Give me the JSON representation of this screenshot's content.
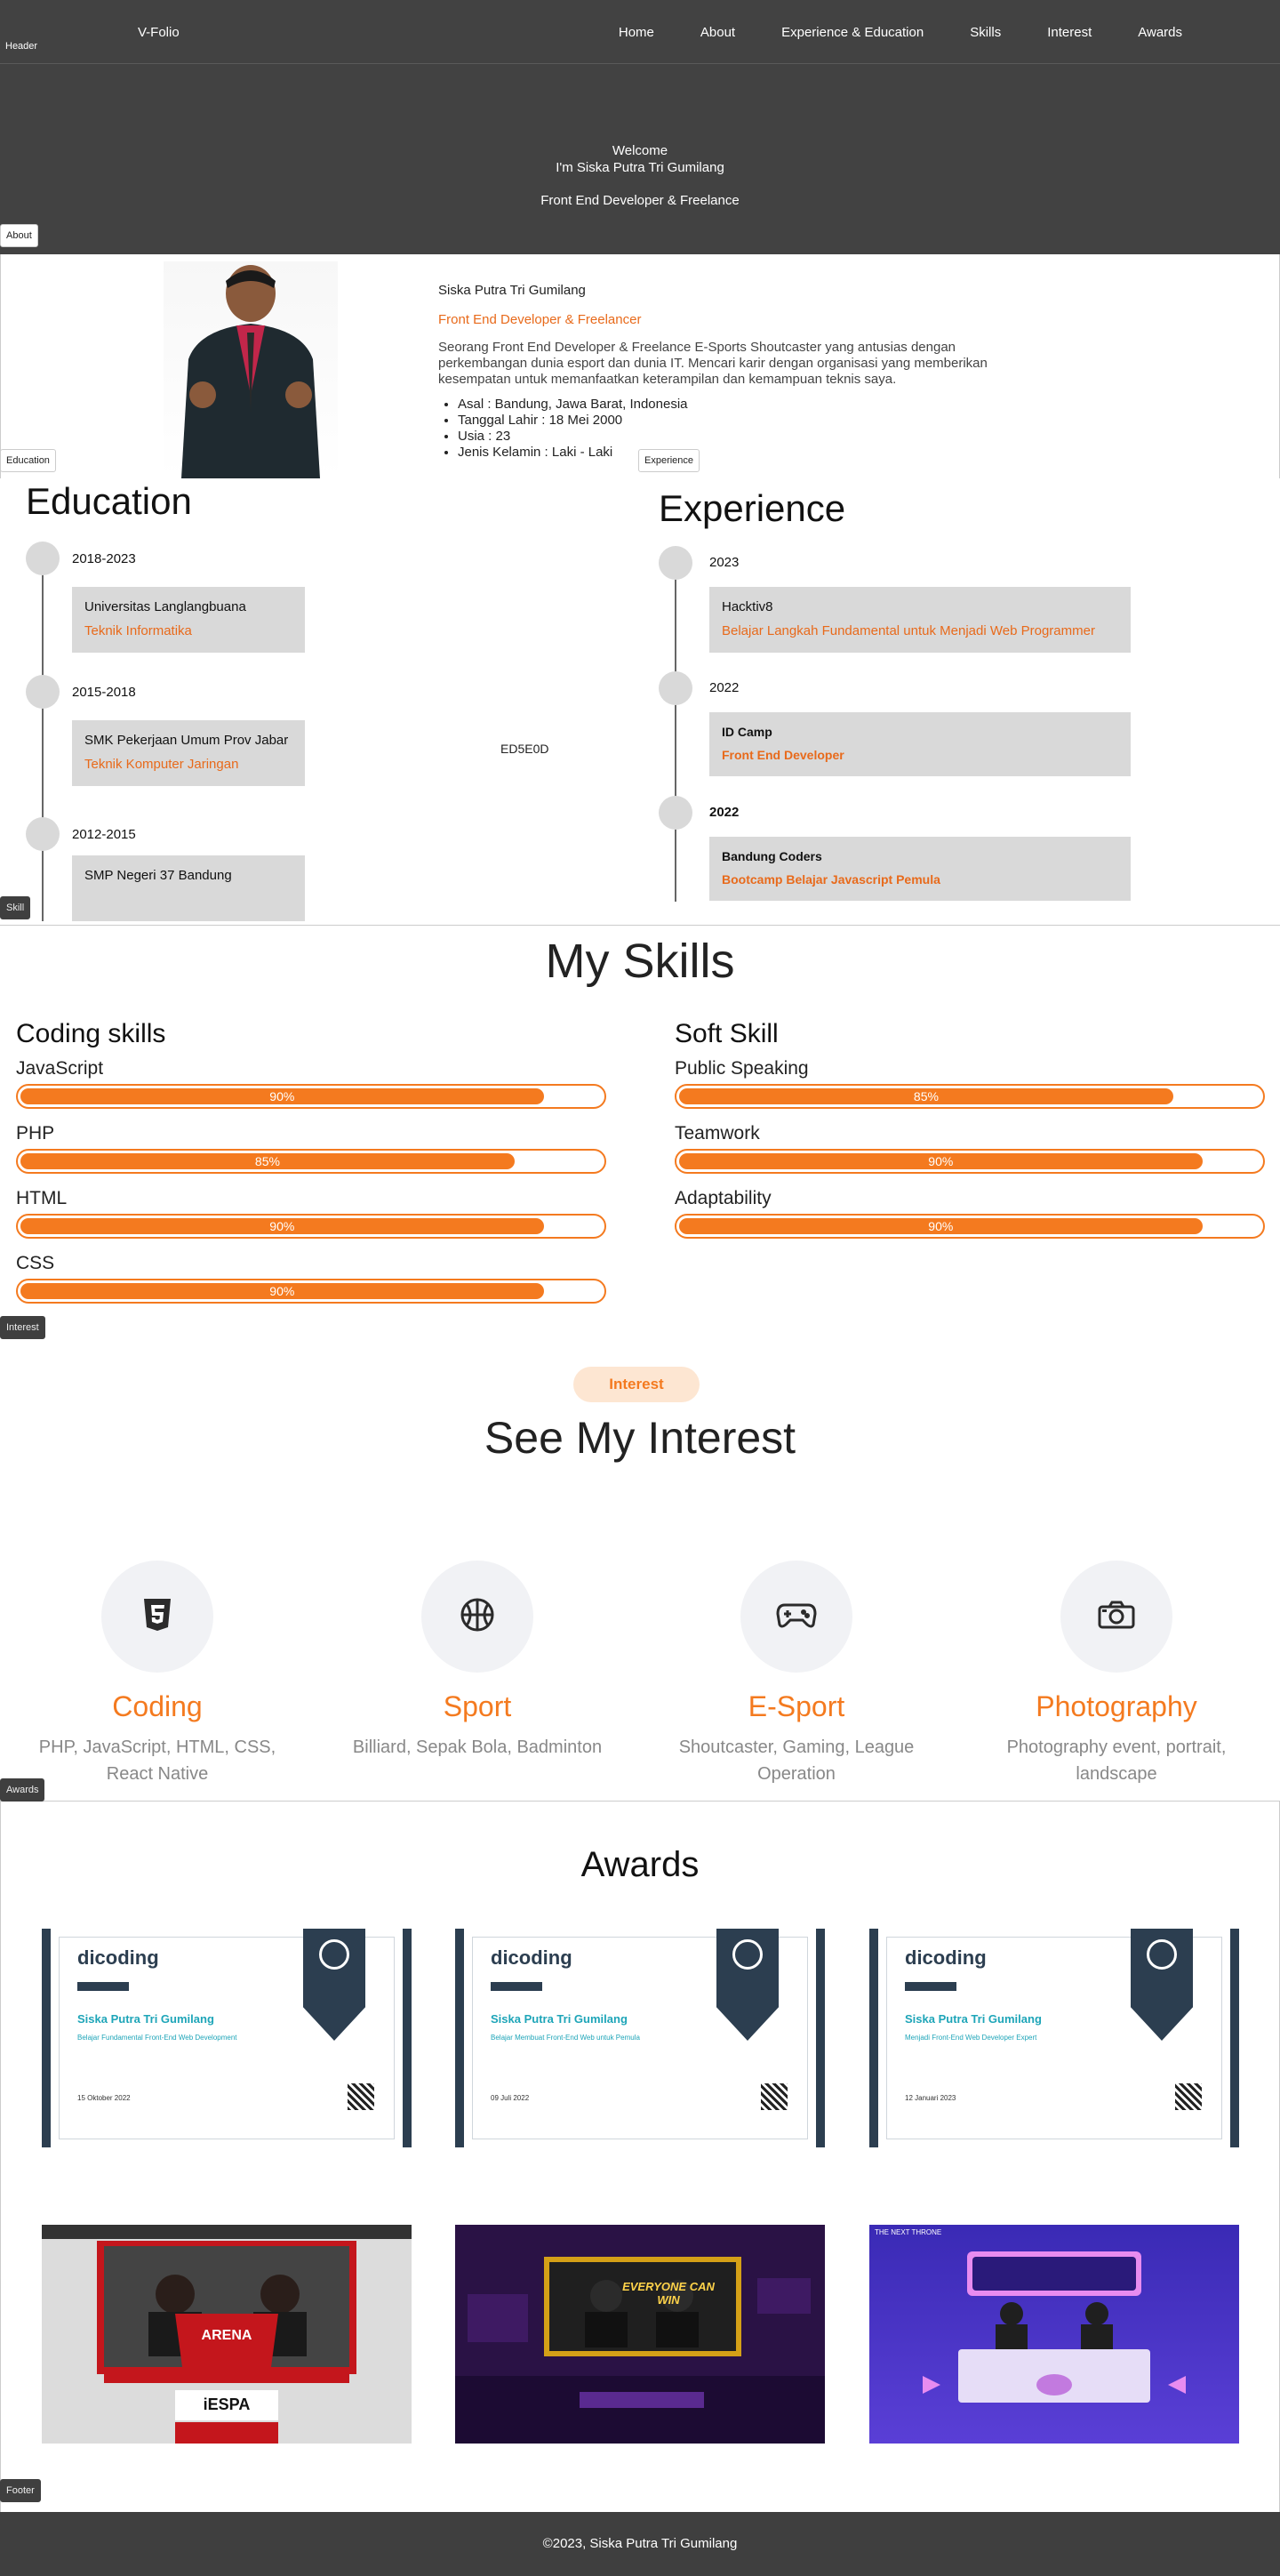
{
  "header": {
    "brand": "V-Folio",
    "tag": "Header",
    "nav": [
      "Home",
      "About",
      "Experience & Education",
      "Skills",
      "Interest",
      "Awards"
    ]
  },
  "hero": {
    "welcome": "Welcome",
    "intro": "I'm Siska Putra Tri Gumilang",
    "role": "Front End Developer & Freelance"
  },
  "tags": {
    "about": "About",
    "education": "Education",
    "experience": "Experience",
    "skill": "Skill",
    "interest": "Interest",
    "awards": "Awards",
    "footer": "Footer"
  },
  "about": {
    "name": "Siska Putra Tri Gumilang",
    "role": "Front End Developer & Freelancer",
    "description": "Seorang Front End Developer & Freelance E-Sports Shoutcaster yang antusias dengan perkembangan dunia esport dan dunia IT. Mencari karir dengan organisasi yang memberikan kesempatan untuk memanfaatkan keterampilan dan kemampuan teknis saya.",
    "details": [
      "Asal : Bandung, Jawa Barat, Indonesia",
      "Tanggal Lahir : 18 Mei 2000",
      "Usia : 23",
      "Jenis Kelamin : Laki - Laki"
    ]
  },
  "education": {
    "title": "Education",
    "items": [
      {
        "year": "2018-2023",
        "school": "Universitas Langlangbuana",
        "major": "Teknik Informatika"
      },
      {
        "year": "2015-2018",
        "school": "SMK Pekerjaan Umum Prov Jabar",
        "major": "Teknik Komputer Jaringan"
      },
      {
        "year": "2012-2015",
        "school": "SMP Negeri 37 Bandung",
        "major": ""
      }
    ]
  },
  "center_note": "ED5E0D",
  "experience": {
    "title": "Experience",
    "items": [
      {
        "year": "2023",
        "org": "Hacktiv8",
        "desc": "Belajar Langkah Fundamental untuk Menjadi Web Programmer"
      },
      {
        "year": "2022",
        "org": "ID Camp",
        "desc": "Front End Developer"
      },
      {
        "year": "2022",
        "org": "Bandung Coders",
        "desc": "Bootcamp Belajar Javascript Pemula"
      }
    ]
  },
  "skills": {
    "title": "My Skills",
    "coding": {
      "title": "Coding skills",
      "items": [
        {
          "name": "JavaScript",
          "value": 90,
          "label": "90%"
        },
        {
          "name": "PHP",
          "value": 85,
          "label": "85%"
        },
        {
          "name": "HTML",
          "value": 90,
          "label": "90%"
        },
        {
          "name": "CSS",
          "value": 90,
          "label": "90%"
        }
      ]
    },
    "soft": {
      "title": "Soft Skill",
      "items": [
        {
          "name": "Public Speaking",
          "value": 85,
          "label": "85%"
        },
        {
          "name": "Teamwork",
          "value": 90,
          "label": "90%"
        },
        {
          "name": "Adaptability",
          "value": 90,
          "label": "90%"
        }
      ]
    }
  },
  "interest": {
    "pill": "Interest",
    "title": "See My Interest",
    "items": [
      {
        "name": "Coding",
        "desc": "PHP, JavaScript, HTML, CSS, React Native",
        "icon": "html5-icon"
      },
      {
        "name": "Sport",
        "desc": "Billiard, Sepak Bola, Badminton",
        "icon": "basketball-icon"
      },
      {
        "name": "E-Sport",
        "desc": "Shoutcaster, Gaming, League Operation",
        "icon": "gamepad-icon"
      },
      {
        "name": "Photography",
        "desc": "Photography event, portrait, landscape",
        "icon": "camera-icon"
      }
    ]
  },
  "awards": {
    "title": "Awards",
    "certs": [
      {
        "logo": "dicoding",
        "name": "Siska Putra Tri Gumilang",
        "course": "Belajar Fundamental Front-End Web Development",
        "date": "15 Oktober 2022"
      },
      {
        "logo": "dicoding",
        "name": "Siska Putra Tri Gumilang",
        "course": "Belajar Membuat Front-End Web untuk Pemula",
        "date": "09 Juli 2022"
      },
      {
        "logo": "dicoding",
        "name": "Siska Putra Tri Gumilang",
        "course": "Menjadi Front-End Web Developer Expert",
        "date": "12 Januari 2023"
      }
    ],
    "photos": [
      {
        "caption": "ARENA",
        "sub": "iESPA"
      },
      {
        "caption": "EVERYONE CAN WIN",
        "sub": ""
      },
      {
        "caption": "THE NEXT THRONE",
        "sub": ""
      }
    ]
  },
  "footer": {
    "text": "©2023, Siska Putra Tri Gumilang"
  },
  "colors": {
    "accent": "#f47a1f",
    "orange_text": "#e86a1b",
    "dark": "#424242"
  }
}
